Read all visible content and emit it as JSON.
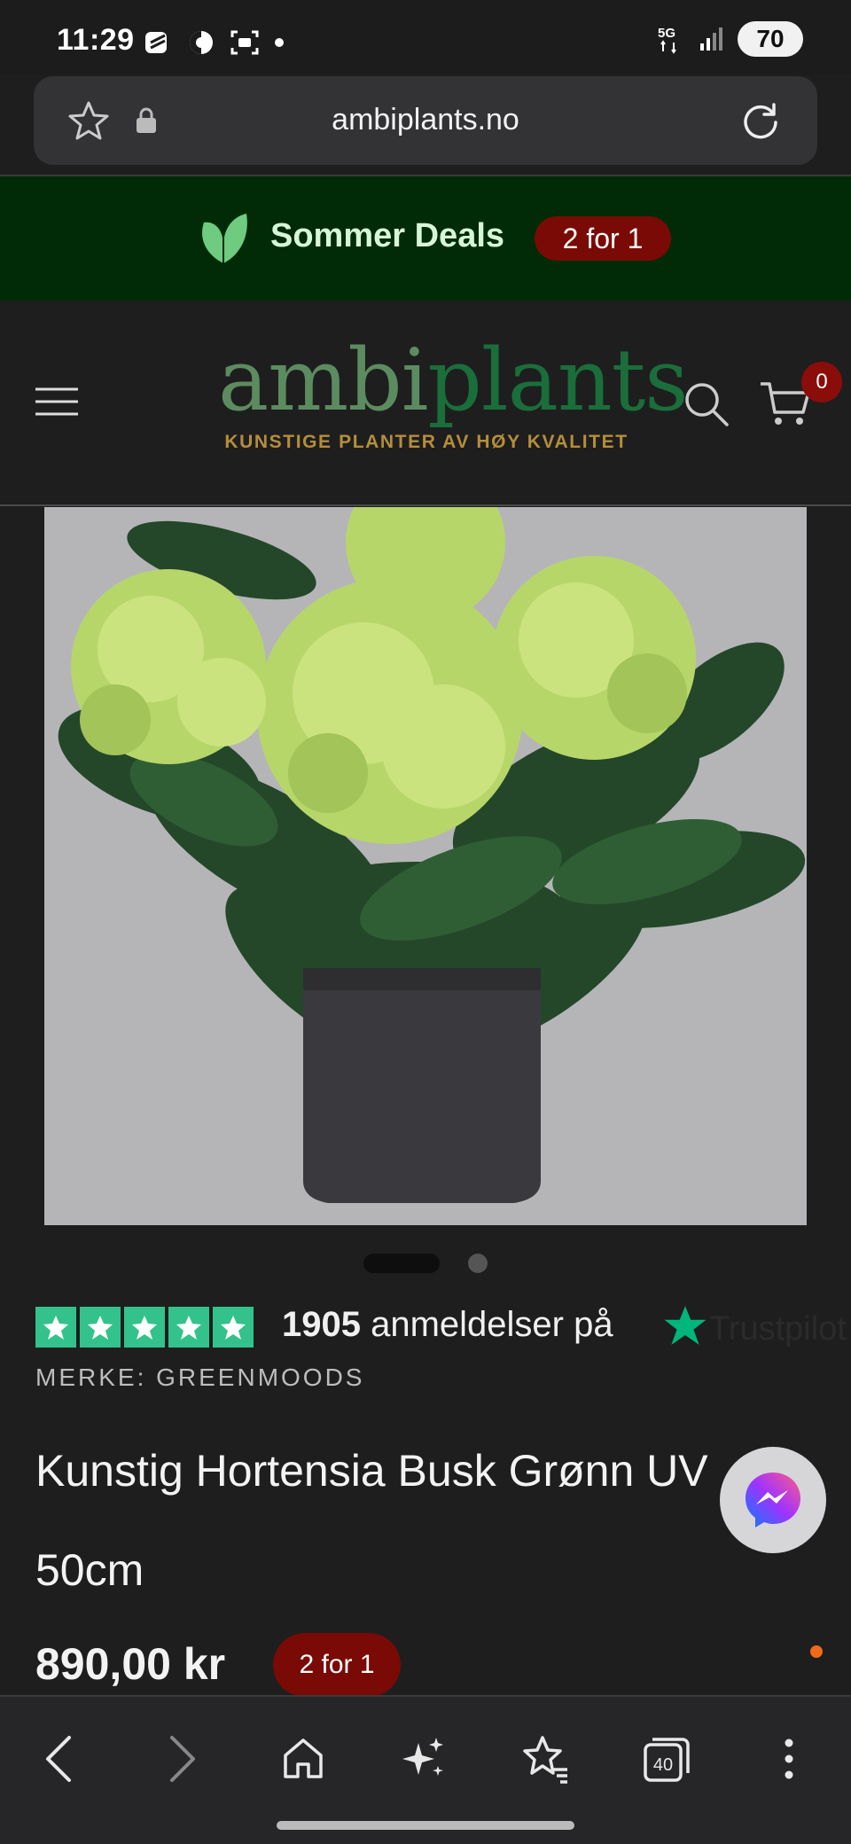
{
  "status_bar": {
    "time": "11:29",
    "network": "5G",
    "battery": "70"
  },
  "browser": {
    "url": "ambiplants.no"
  },
  "promo": {
    "text": "Sommer Deals",
    "badge": "2 for 1"
  },
  "header": {
    "logo_part1": "ambi",
    "logo_part2": "plants",
    "tagline": "KUNSTIGE PLANTER AV HØY KVALITET",
    "cart_count": "0"
  },
  "reviews": {
    "count": "1905",
    "text": "anmeldelser på",
    "provider": "Trustpilot"
  },
  "product": {
    "brand": "MERKE: GREENMOODS",
    "title_line1": "Kunstig Hortensia Busk Grønn UV",
    "title_line2": "50cm",
    "price": "890,00 kr",
    "price_badge": "2 for 1"
  },
  "bottom_nav": {
    "tabs_count": "40"
  },
  "colors": {
    "promo_bg": "#012a06",
    "badge_red": "#7a0a05",
    "trustpilot_green": "#00b67a",
    "logo_gold": "#b58e3a"
  }
}
